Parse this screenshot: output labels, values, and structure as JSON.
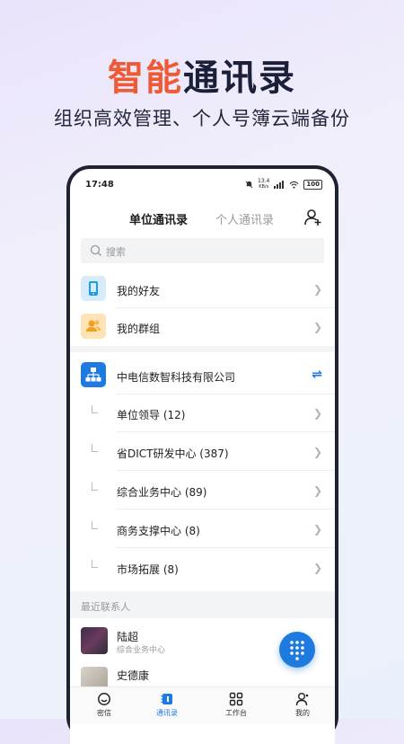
{
  "headline": {
    "accent": "智能",
    "rest": "通讯录"
  },
  "subtitle": "组织高效管理、个人号簿云端备份",
  "status_bar": {
    "time": "17:48",
    "speed": "13.4",
    "speed_unit": "KB/s",
    "battery": "100"
  },
  "tabs": [
    {
      "label": "单位通讯录"
    },
    {
      "label": "个人通讯录"
    }
  ],
  "search": {
    "placeholder": "搜索"
  },
  "quick_items": [
    {
      "label": "我的好友"
    },
    {
      "label": "我的群组"
    }
  ],
  "org": {
    "name": "中电信数智科技有限公司",
    "departments": [
      {
        "label": "单位领导 (12)"
      },
      {
        "label": "省DICT研发中心 (387)"
      },
      {
        "label": "综合业务中心 (89)"
      },
      {
        "label": "商务支撑中心 (8)"
      },
      {
        "label": "市场拓展 (8)"
      }
    ]
  },
  "recent": {
    "title": "最近联系人",
    "contacts": [
      {
        "name": "陆超",
        "dept": "综合业务中心"
      },
      {
        "name": "史德康",
        "dept": ""
      }
    ]
  },
  "bottom_nav": [
    {
      "label": "密信"
    },
    {
      "label": "通讯录"
    },
    {
      "label": "工作台"
    },
    {
      "label": "我的"
    }
  ],
  "colors": {
    "accent": "#ee5a36",
    "primary": "#1f7ae0",
    "dark": "#1c1f3a"
  }
}
